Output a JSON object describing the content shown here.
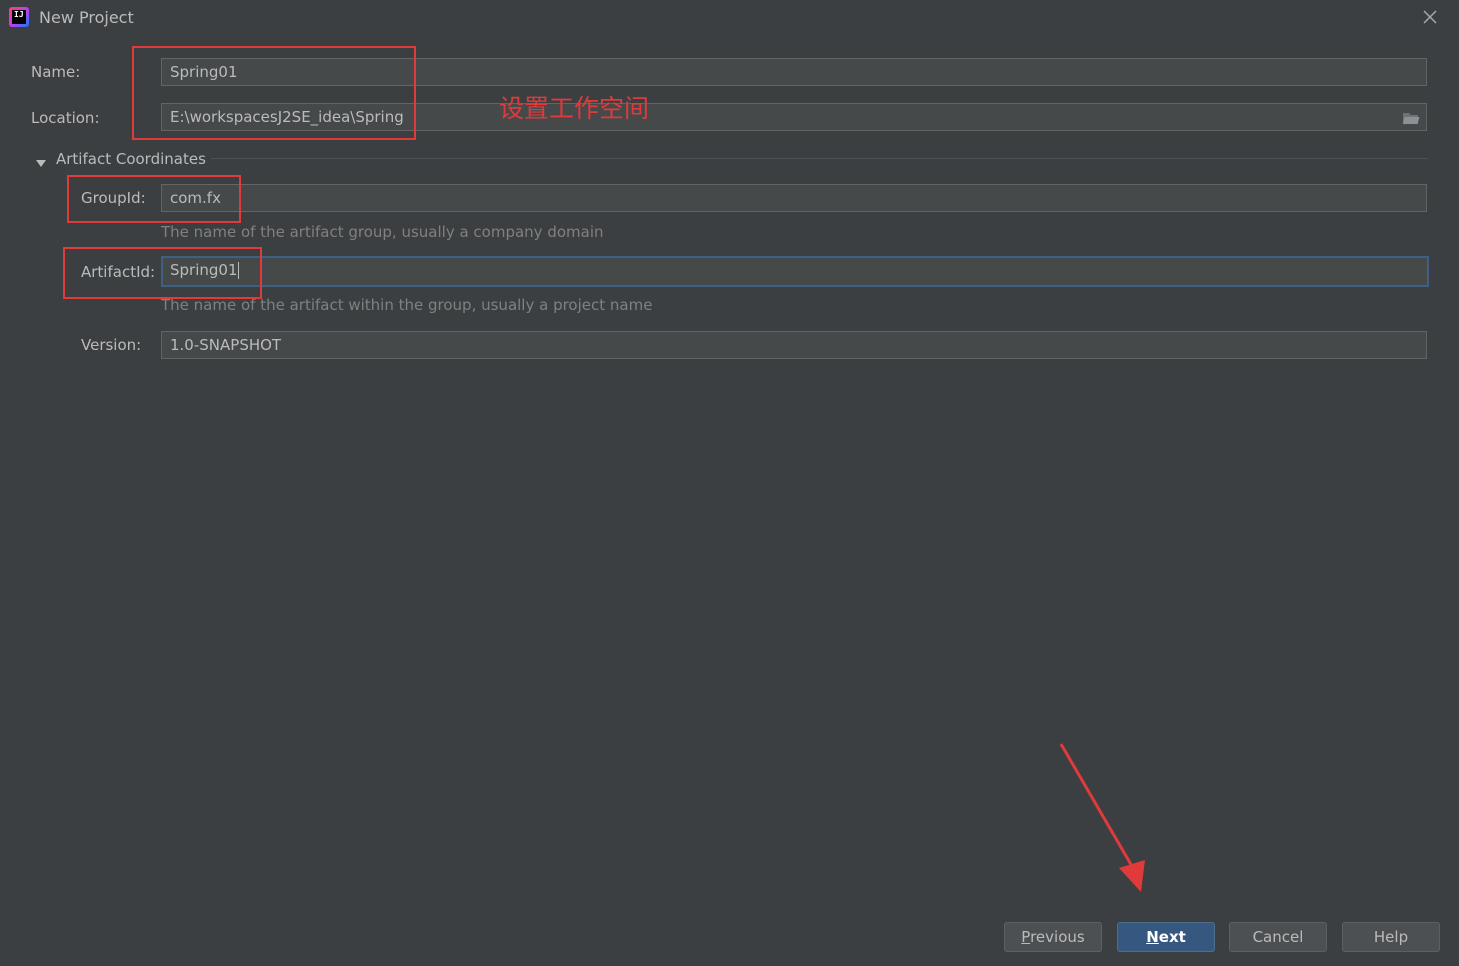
{
  "window": {
    "title": "New Project"
  },
  "form": {
    "name_label": "Name:",
    "name_value": "Spring01",
    "location_label": "Location:",
    "location_value": "E:\\workspacesJ2SE_idea\\Spring"
  },
  "artifact": {
    "section_title": "Artifact Coordinates",
    "groupid_label": "GroupId:",
    "groupid_value": "com.fx",
    "groupid_hint": "The name of the artifact group, usually a company domain",
    "artifactid_label": "ArtifactId:",
    "artifactid_value": "Spring01",
    "artifactid_hint": "The name of the artifact within the group, usually a project name",
    "version_label": "Version:",
    "version_value": "1.0-SNAPSHOT"
  },
  "annotation": {
    "text": "设置工作空间",
    "color": "#e03a3a"
  },
  "buttons": {
    "previous_mnemonic": "P",
    "previous_rest": "revious",
    "next_mnemonic": "N",
    "next_rest": "ext",
    "cancel": "Cancel",
    "help": "Help"
  },
  "colors": {
    "background": "#3c3f41",
    "field": "#45494a",
    "primary_button": "#365880",
    "focus_border": "#3d6185"
  }
}
